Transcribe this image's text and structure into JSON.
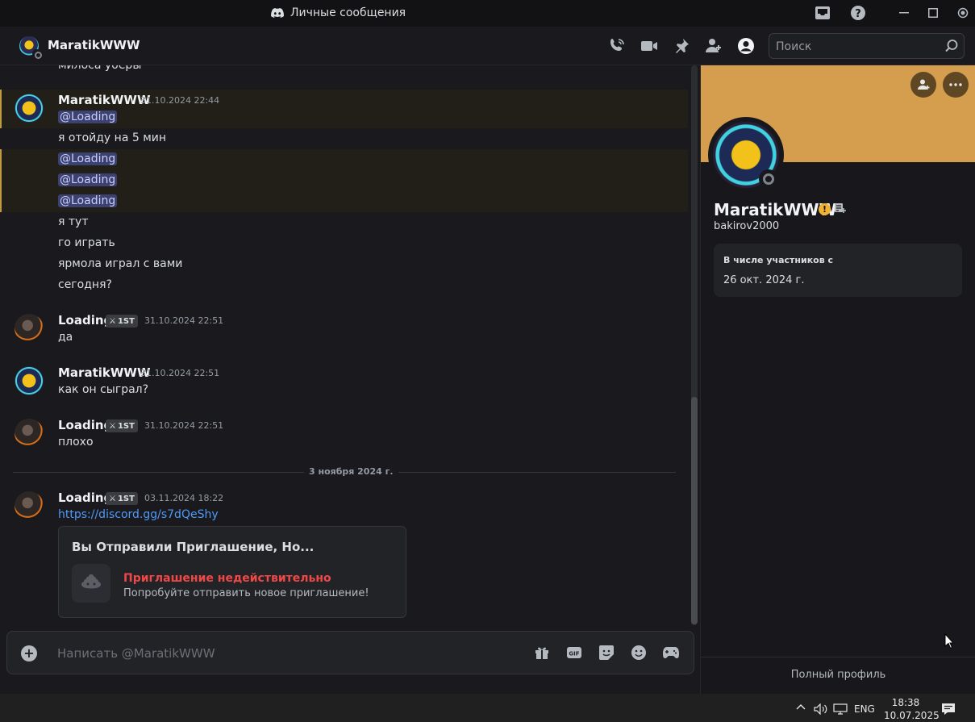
{
  "window": {
    "title": "Личные сообщения"
  },
  "header": {
    "dm_name": "MaratikWWW",
    "search_placeholder": "Поиск"
  },
  "chat": {
    "partial_line": "милоса уберы",
    "messages": [
      {
        "author": "MaratikWWW",
        "timestamp": "31.10.2024 22:44",
        "lines": [
          "@Loading",
          "я отойду на 5 мин",
          "@Loading",
          "@Loading",
          "@Loading",
          "я тут",
          "го играть",
          "ярмола играл с вами",
          "сегодня?"
        ]
      },
      {
        "author": "Loading",
        "badge": "1ST",
        "timestamp": "31.10.2024 22:51",
        "lines": [
          "да"
        ]
      },
      {
        "author": "MaratikWWW",
        "timestamp": "31.10.2024 22:51",
        "lines": [
          "как он сыграл?"
        ]
      },
      {
        "author": "Loading",
        "badge": "1ST",
        "timestamp": "31.10.2024 22:51",
        "lines": [
          "плохо"
        ]
      },
      {
        "author": "Loading",
        "badge": "1ST",
        "timestamp": "03.11.2024 18:22",
        "link": "https://discord.gg/s7dQeShy"
      }
    ],
    "date_divider": "3 ноября 2024 г.",
    "embed": {
      "title": "Вы Отправили Приглашение, Но...",
      "invalid": "Приглашение недействительно",
      "subtitle": "Попробуйте отправить новое приглашение!"
    }
  },
  "composer": {
    "placeholder": "Написать @MaratikWWW"
  },
  "profile": {
    "display_name": "MaratikWWW",
    "username": "bakirov2000",
    "member_since_label": "В числе участников с",
    "member_since": "26 окт. 2024 г.",
    "full_profile": "Полный профиль",
    "banner_color": "#d49e4e"
  },
  "taskbar": {
    "lang": "ENG",
    "time": "18:38",
    "date": "10.07.2025"
  }
}
